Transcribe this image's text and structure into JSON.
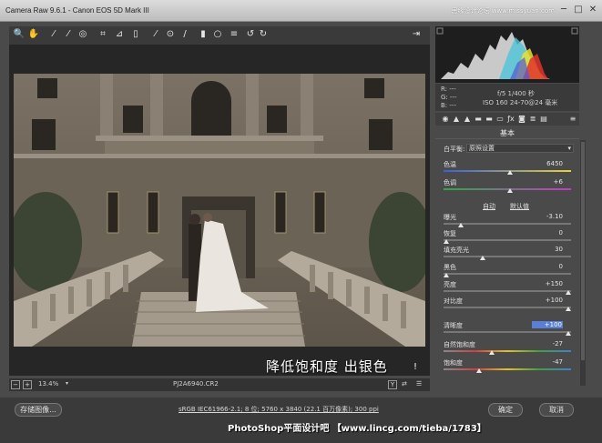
{
  "window": {
    "title": "Camera Raw 9.6.1 -  Canon EOS 5D Mark III",
    "watermark": "思缘设计论坛  www.missyuan.com",
    "min_glyph": "─",
    "max_glyph": "□",
    "close_glyph": "✕"
  },
  "toolbar": {
    "tools": [
      {
        "icon": "zoom-icon",
        "glyph": "🔍"
      },
      {
        "icon": "hand-icon",
        "glyph": "✋"
      },
      {
        "icon": "white-balance-icon",
        "glyph": "⁄"
      },
      {
        "icon": "color-sampler-icon",
        "glyph": "⁄"
      },
      {
        "icon": "targeted-adjust-icon",
        "glyph": "◎"
      },
      {
        "icon": "crop-icon",
        "glyph": "⌗"
      },
      {
        "icon": "straighten-icon",
        "glyph": "⊿"
      },
      {
        "icon": "transform-icon",
        "glyph": "▯"
      },
      {
        "icon": "spot-removal-icon",
        "glyph": "⁄"
      },
      {
        "icon": "red-eye-icon",
        "glyph": "⊙"
      },
      {
        "icon": "adjustment-brush-icon",
        "glyph": "/"
      },
      {
        "icon": "graduated-filter-icon",
        "glyph": "▮"
      },
      {
        "icon": "radial-filter-icon",
        "glyph": "○"
      },
      {
        "icon": "preferences-icon",
        "glyph": "≡"
      },
      {
        "icon": "rotate-ccw-icon",
        "glyph": "↺"
      },
      {
        "icon": "rotate-cw-icon",
        "glyph": "↻"
      }
    ],
    "export_glyph": "⇥"
  },
  "overlay": {
    "caption": "降低饱和度 出银色",
    "mark": "!"
  },
  "status": {
    "zoom": "13.4%",
    "filename": "PJ2A6940.CR2",
    "minus": "−",
    "plus": "+",
    "y_glyph": "Y"
  },
  "bottom": {
    "save_label": "存储图像...",
    "workflow_link": "sRGB IEC61966-2.1; 8 位; 5760 x 3840 (22.1 百万像素); 300 ppi",
    "ok_label": "确定",
    "cancel_label": "取消",
    "credit": "PhotoShop平面设计吧 【www.lincg.com/tieba/1783】"
  },
  "info": {
    "r": "R:  ---",
    "g": "G:  ---",
    "b": "B:  ---",
    "aperture_shutter": "f/5   1/400 秒",
    "iso_lens": "ISO 160   24-70@24 毫米"
  },
  "panel": {
    "section_title": "基本",
    "wb_label": "白平衡:",
    "wb_value": "原照设置",
    "auto": "自动",
    "default": "默认值",
    "sliders": [
      {
        "name": "temperature",
        "label": "色温",
        "value": "6450",
        "pos": 0.52
      },
      {
        "name": "tint",
        "label": "色调",
        "value": "+6",
        "pos": 0.52
      },
      {
        "name": "exposure",
        "label": "曝光",
        "value": "-3.10",
        "pos": 0.12
      },
      {
        "name": "recovery",
        "label": "恢复",
        "value": "0",
        "pos": 0.0
      },
      {
        "name": "fill-light",
        "label": "填充亮光",
        "value": "30",
        "pos": 0.3
      },
      {
        "name": "blacks",
        "label": "黑色",
        "value": "0",
        "pos": 0.0
      },
      {
        "name": "brightness",
        "label": "亮度",
        "value": "+150",
        "pos": 1.0
      },
      {
        "name": "contrast",
        "label": "对比度",
        "value": "+100",
        "pos": 1.0
      },
      {
        "name": "clarity",
        "label": "清晰度",
        "value": "+100",
        "pos": 1.0
      },
      {
        "name": "vibrance",
        "label": "自然饱和度",
        "value": "-27",
        "pos": 0.37
      },
      {
        "name": "saturation",
        "label": "饱和度",
        "value": "-47",
        "pos": 0.27
      }
    ]
  },
  "colors": {
    "accent": "#5a7fd6",
    "panel": "#4a4a4a"
  }
}
